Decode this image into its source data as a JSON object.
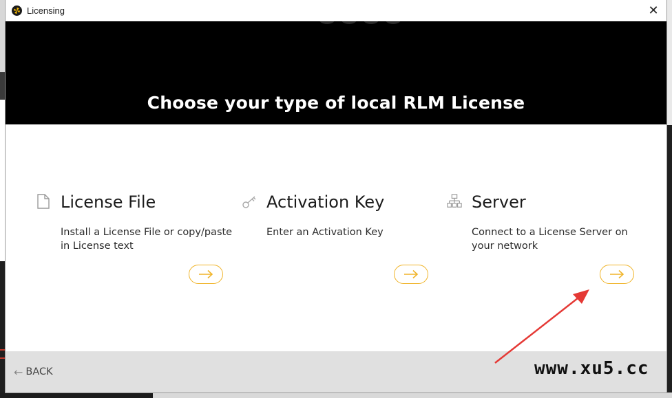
{
  "window": {
    "title": "Licensing",
    "close_glyph": "✕"
  },
  "banner": {
    "title": "Choose your type of local RLM License"
  },
  "options": [
    {
      "icon": "document-icon",
      "title": "License File",
      "description": "Install a License File or copy/paste in License text",
      "action_glyph": "→"
    },
    {
      "icon": "key-icon",
      "title": "Activation Key",
      "description": "Enter an Activation Key",
      "action_glyph": "→"
    },
    {
      "icon": "network-icon",
      "title": "Server",
      "description": "Connect to a License Server on your network",
      "action_glyph": "→"
    }
  ],
  "footer": {
    "back_label": "BACK",
    "back_glyph": "←"
  },
  "watermark": "www.xu5.cc",
  "colors": {
    "accent": "#f0b429",
    "banner_bg": "#000000",
    "footer_bg": "#e0e0e0",
    "annotation": "#e53935"
  }
}
